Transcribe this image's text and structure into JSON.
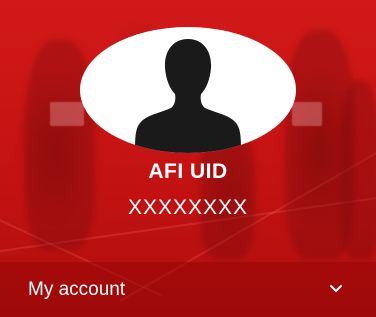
{
  "profile": {
    "title": "AFI UID",
    "uid": "XXXXXXXX"
  },
  "menu": {
    "account_label": "My account"
  },
  "icons": {
    "avatar": "user-silhouette-icon",
    "expand": "chevron-down-icon"
  },
  "colors": {
    "brand_red": "#c51313",
    "text": "#ffffff",
    "avatar_bg": "#ffffff",
    "silhouette": "#1a1a1a"
  }
}
